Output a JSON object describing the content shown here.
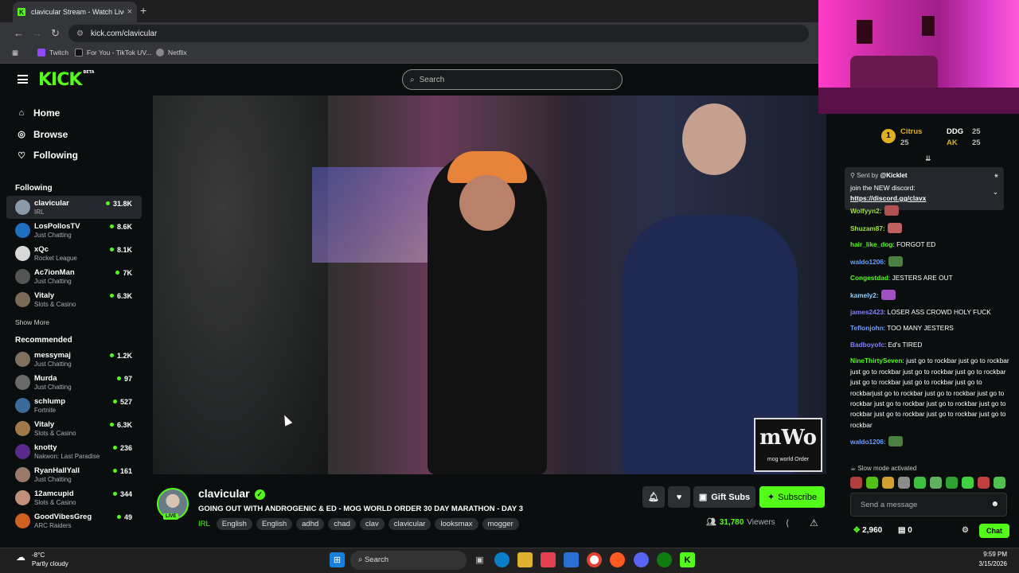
{
  "browser": {
    "tab_title": "clavicular Stream - Watch Live o",
    "tab_favicon": "K",
    "tab_close": "×",
    "new_tab": "+",
    "url": "kick.com/clavicular",
    "bookmarks": [
      "Twitch",
      "For You - TikTok UV...",
      "Netflix"
    ]
  },
  "site": {
    "logo": "KICK",
    "logo_badge": "BETA",
    "search_placeholder": "Search"
  },
  "sidebar": {
    "nav": [
      "Home",
      "Browse",
      "Following"
    ],
    "following_header": "Following",
    "following": [
      {
        "name": "clavicular",
        "category": "IRL",
        "viewers": "31.8K"
      },
      {
        "name": "LosPollosTV",
        "category": "Just Chatting",
        "viewers": "8.6K"
      },
      {
        "name": "xQc",
        "category": "Rocket League",
        "viewers": "8.1K"
      },
      {
        "name": "Ac7ionMan",
        "category": "Just Chatting",
        "viewers": "7K"
      },
      {
        "name": "Vitaly",
        "category": "Slots & Casino",
        "viewers": "6.3K"
      }
    ],
    "show_more": "Show More",
    "recommended_header": "Recommended",
    "recommended": [
      {
        "name": "messymaj",
        "category": "Just Chatting",
        "viewers": "1.2K"
      },
      {
        "name": "Murda",
        "category": "Just Chatting",
        "viewers": "97"
      },
      {
        "name": "schlump",
        "category": "Fortnite",
        "viewers": "527"
      },
      {
        "name": "Vitaly",
        "category": "Slots & Casino",
        "viewers": "6.3K"
      },
      {
        "name": "knotty",
        "category": "Nakwon: Last Paradise",
        "viewers": "236"
      },
      {
        "name": "RyanHallYall",
        "category": "Just Chatting",
        "viewers": "161"
      },
      {
        "name": "12amcupid",
        "category": "Slots & Casino",
        "viewers": "344"
      },
      {
        "name": "GoodVibesGreg",
        "category": "ARC Raiders",
        "viewers": "49"
      }
    ]
  },
  "video": {
    "overlay_logo": "mWo",
    "overlay_sub": "mog world Order"
  },
  "stream": {
    "streamer": "clavicular",
    "live_badge": "LIVE",
    "title": "GOING OUT WITH ANDROGENIC & ED - MOG WORLD ORDER 30 DAY MARATHON - DAY 3",
    "category": "IRL",
    "tags": [
      "English",
      "English",
      "adhd",
      "chad",
      "clav",
      "clavicular",
      "looksmax",
      "mogger"
    ],
    "gift_subs": "Gift Subs",
    "subscribe": "Subscribe",
    "viewers": "31,780",
    "viewers_label": "Viewers"
  },
  "chat": {
    "leaderboard": [
      {
        "rank": "1",
        "name": "Citrus",
        "count": "25"
      },
      {
        "name": "DDG",
        "count": "25"
      },
      {
        "name": "AK",
        "count": "25"
      }
    ],
    "pinned": {
      "sent_by": "Sent by",
      "sender": "@Kicklet",
      "line1": "join the NEW discord:",
      "link": "https://discord.gg/clavx"
    },
    "messages": [
      {
        "user": "Wolfyyn2:",
        "text": "",
        "color": "#a0e040",
        "emote": "#b05050"
      },
      {
        "user": "Shuzam87:",
        "text": "",
        "color": "#a0e040",
        "emote": "#c06060"
      },
      {
        "user": "hair_like_dog",
        "text": ": FORGOT ED",
        "color": "#53fc18"
      },
      {
        "user": "waldo1206:",
        "text": "",
        "color": "#6aa0ff",
        "emote": "#4a8040"
      },
      {
        "user": "Congestdad",
        "text": ": JESTERS ARE OUT",
        "color": "#53fc18"
      },
      {
        "user": "kamely2:",
        "text": "",
        "color": "#8fd0ff",
        "emote": "#a050c0"
      },
      {
        "user": "james2423",
        "text": ": LOSER ASS CROWD HOLY FUCK",
        "color": "#8080ff"
      },
      {
        "user": "Teflonjohn",
        "text": ": TOO MANY JESTERS",
        "color": "#6aa0ff"
      },
      {
        "user": "Badboyofc",
        "text": ": Ed's TIRED",
        "color": "#8080ff"
      },
      {
        "user": "NineThirtySeven",
        "text": ": just go to rockbar just go to rockbar just go to rockbar just go to rockbar just go to rockbar just go to rockbar just go to rockbar just go to rockbarjust go to rockbar just go to rockbar just go to rockbar just go to rockbar just go to rockbar just go to rockbar just go to rockbar just go to rockbar just go to rockbar",
        "color": "#53fc18"
      },
      {
        "user": "waldo1206:",
        "text": "",
        "color": "#6aa0ff",
        "emote": "#4a8040"
      }
    ],
    "slow_mode": "Slow mode activated",
    "input_placeholder": "Send a message",
    "points": "2,960",
    "count": "0",
    "chat_button": "Chat"
  },
  "taskbar": {
    "temp": "-8°C",
    "weather": "Partly cloudy",
    "search": "Search",
    "time": "9:59 PM",
    "date": "3/15/2026"
  },
  "colors": {
    "accent": "#53fc18",
    "bg": "#0b0e0f",
    "panel": "#24272c"
  }
}
